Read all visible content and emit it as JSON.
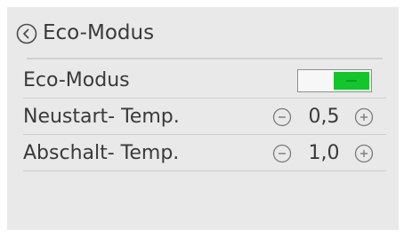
{
  "header": {
    "title": "Eco-Modus",
    "back_icon": "chevron-left-circle-icon"
  },
  "settings": [
    {
      "label": "Eco-Modus",
      "control": "toggle",
      "state": "on",
      "on_color": "#12c62b"
    },
    {
      "label": "Neustart- Temp.",
      "control": "stepper",
      "value": "0,5",
      "decrement_icon": "minus-circle-icon",
      "increment_icon": "plus-circle-icon"
    },
    {
      "label": "Abschalt- Temp.",
      "control": "stepper",
      "value": "1,0",
      "decrement_icon": "minus-circle-icon",
      "increment_icon": "plus-circle-icon"
    }
  ],
  "colors": {
    "background": "#e9e9e9",
    "text": "#3a3a3a",
    "toggle_on": "#12c62b"
  }
}
